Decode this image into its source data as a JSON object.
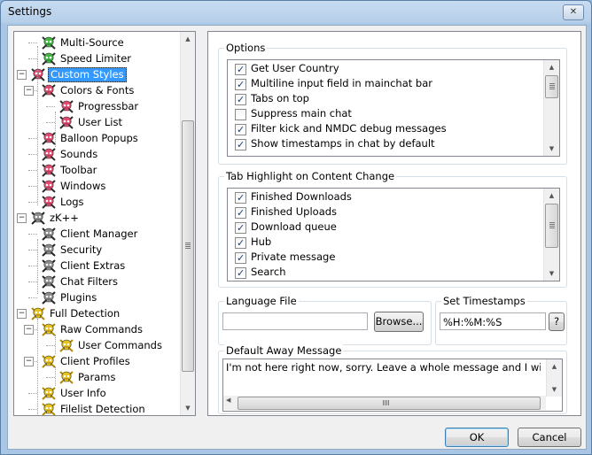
{
  "window": {
    "title": "Settings",
    "close_symbol": "✕"
  },
  "tree": {
    "items": [
      {
        "label": "Multi-Source",
        "level": 1,
        "icon": "green-skull-icon"
      },
      {
        "label": "Speed Limiter",
        "level": 1,
        "icon": "green-skull-icon"
      },
      {
        "label": "Custom Styles",
        "level": 0,
        "icon": "pink-skull-icon",
        "selected": true,
        "expander": "−"
      },
      {
        "label": "Colors & Fonts",
        "level": 1,
        "icon": "pink-skull-icon",
        "expander": "−"
      },
      {
        "label": "Progressbar",
        "level": 2,
        "icon": "pink-skull-icon"
      },
      {
        "label": "User List",
        "level": 2,
        "icon": "pink-skull-icon"
      },
      {
        "label": "Balloon Popups",
        "level": 1,
        "icon": "pink-skull-icon"
      },
      {
        "label": "Sounds",
        "level": 1,
        "icon": "pink-skull-icon"
      },
      {
        "label": "Toolbar",
        "level": 1,
        "icon": "pink-skull-icon"
      },
      {
        "label": "Windows",
        "level": 1,
        "icon": "pink-skull-icon"
      },
      {
        "label": "Logs",
        "level": 1,
        "icon": "pink-skull-icon"
      },
      {
        "label": "zK++",
        "level": 0,
        "icon": "grey-skull-icon",
        "expander": "−"
      },
      {
        "label": "Client Manager",
        "level": 1,
        "icon": "grey-skull-icon"
      },
      {
        "label": "Security",
        "level": 1,
        "icon": "grey-skull-icon"
      },
      {
        "label": "Client Extras",
        "level": 1,
        "icon": "grey-skull-icon"
      },
      {
        "label": "Chat Filters",
        "level": 1,
        "icon": "grey-skull-icon"
      },
      {
        "label": "Plugins",
        "level": 1,
        "icon": "grey-skull-icon"
      },
      {
        "label": "Full Detection",
        "level": 0,
        "icon": "yellow-skull-icon",
        "expander": "−"
      },
      {
        "label": "Raw Commands",
        "level": 1,
        "icon": "yellow-skull-icon",
        "expander": "−"
      },
      {
        "label": "User Commands",
        "level": 2,
        "icon": "yellow-skull-icon"
      },
      {
        "label": "Client Profiles",
        "level": 1,
        "icon": "yellow-skull-icon",
        "expander": "−"
      },
      {
        "label": "Params",
        "level": 2,
        "icon": "yellow-skull-icon"
      },
      {
        "label": "User Info",
        "level": 1,
        "icon": "yellow-skull-icon"
      },
      {
        "label": "Filelist Detection",
        "level": 1,
        "icon": "yellow-skull-icon"
      }
    ]
  },
  "options": {
    "title": "Options",
    "items": [
      {
        "label": "Get User Country",
        "checked": true
      },
      {
        "label": "Multiline input field in mainchat bar",
        "checked": true
      },
      {
        "label": "Tabs on top",
        "checked": true
      },
      {
        "label": "Suppress main chat",
        "checked": false
      },
      {
        "label": "Filter kick and NMDC debug messages",
        "checked": true
      },
      {
        "label": "Show timestamps in chat by default",
        "checked": true
      }
    ]
  },
  "tab_highlight": {
    "title": "Tab Highlight on Content Change",
    "items": [
      {
        "label": "Finished Downloads",
        "checked": true
      },
      {
        "label": "Finished Uploads",
        "checked": true
      },
      {
        "label": "Download queue",
        "checked": true
      },
      {
        "label": "Hub",
        "checked": true
      },
      {
        "label": "Private message",
        "checked": true
      },
      {
        "label": "Search",
        "checked": true
      }
    ]
  },
  "language_file": {
    "title": "Language File",
    "value": "",
    "browse_label": "Browse..."
  },
  "timestamps": {
    "title": "Set Timestamps",
    "value": "%H:%M:%S",
    "help_label": "?"
  },
  "away": {
    "title": "Default Away Message",
    "value": "I'm not here right now, sorry. Leave a whole message and I will replay later,"
  },
  "footer": {
    "ok_label": "OK",
    "cancel_label": "Cancel"
  },
  "scroll_glyphs": {
    "up": "▲",
    "down": "▼",
    "left": "◀",
    "right": "▶"
  },
  "colors": {
    "selection": "#3399ff",
    "accent_border": "#3c7fb1"
  }
}
